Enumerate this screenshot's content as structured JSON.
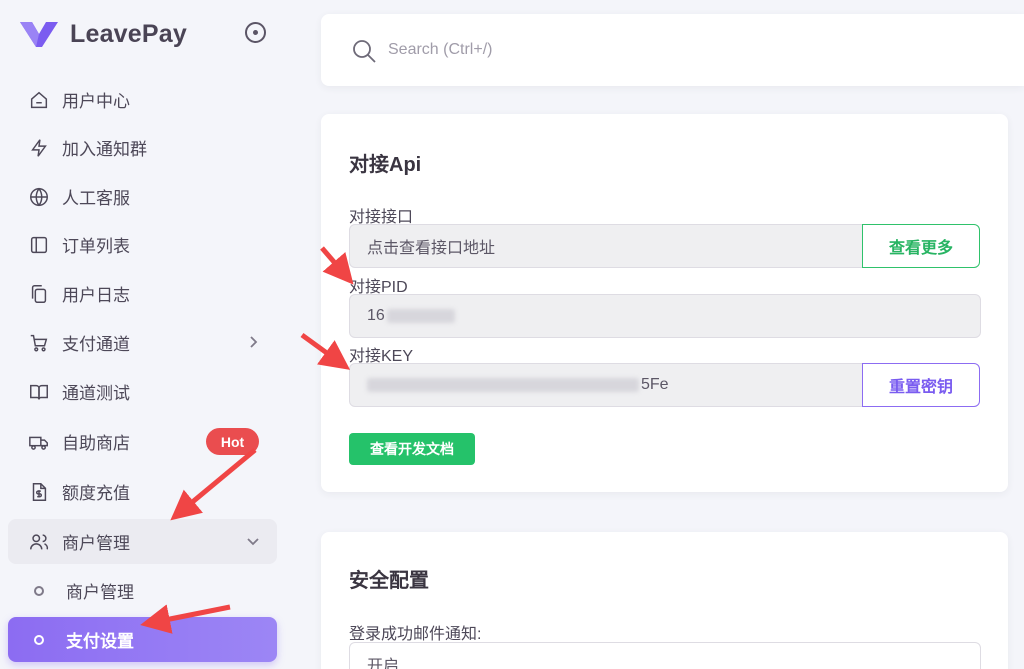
{
  "brand": {
    "name": "LeavePay",
    "logo_icon": "v-logo-icon",
    "accent": "#8c6cf2"
  },
  "sidebar": {
    "items": [
      {
        "label": "用户中心",
        "icon": "home-icon"
      },
      {
        "label": "加入通知群",
        "icon": "lightning-icon"
      },
      {
        "label": "人工客服",
        "icon": "globe-icon"
      },
      {
        "label": "订单列表",
        "icon": "layout-sidebar-icon"
      },
      {
        "label": "用户日志",
        "icon": "copy-icon"
      },
      {
        "label": "支付通道",
        "icon": "cart-icon"
      },
      {
        "label": "通道测试",
        "icon": "book-icon"
      },
      {
        "label": "自助商店",
        "icon": "truck-icon",
        "badge": "Hot"
      },
      {
        "label": "额度充值",
        "icon": "dollar-file-icon"
      },
      {
        "label": "商户管理",
        "icon": "users-icon"
      },
      {
        "label": "商户管理"
      },
      {
        "label": "支付设置"
      }
    ]
  },
  "search": {
    "placeholder": "Search (Ctrl+/)"
  },
  "api_card": {
    "title": "对接Api",
    "endpoint_label": "对接接口",
    "endpoint_value": "点击查看接口地址",
    "endpoint_button": "查看更多",
    "pid_label": "对接PID",
    "pid_value": "16",
    "key_label": "对接KEY",
    "key_value_tail": "5Fe",
    "key_button": "重置密钥",
    "docs_button": "查看开发文档"
  },
  "security_card": {
    "title": "安全配置",
    "login_notify_label": "登录成功邮件通知:",
    "login_notify_value": "开启"
  },
  "colors": {
    "success": "#25c26a",
    "danger": "#ea4d4f",
    "annotation": "#f04545"
  }
}
